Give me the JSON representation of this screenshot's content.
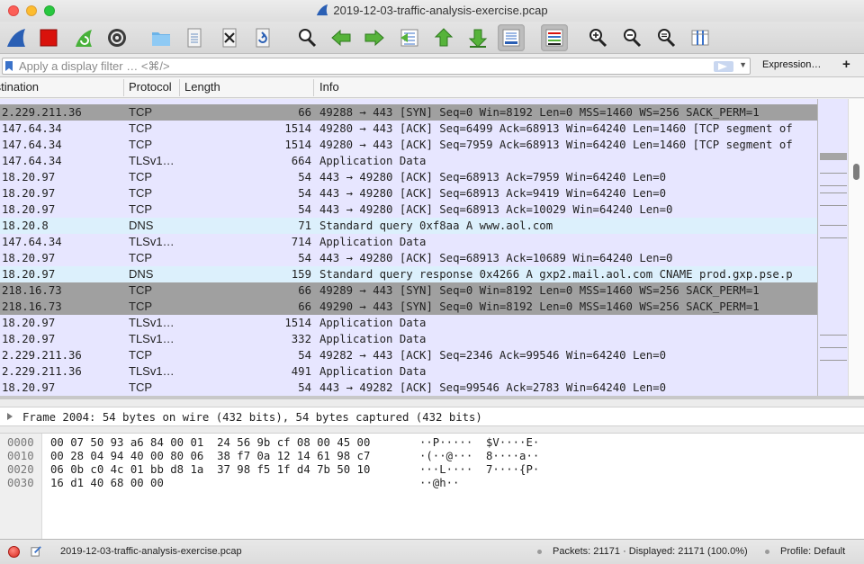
{
  "window": {
    "title": "2019-12-03-traffic-analysis-exercise.pcap"
  },
  "toolbar": {
    "buttons": [
      {
        "name": "start-capture",
        "icon": "shark-fin-icon"
      },
      {
        "name": "stop-capture",
        "icon": "stop-square-icon"
      },
      {
        "name": "restart-capture",
        "icon": "restart-fin-icon"
      },
      {
        "name": "capture-options",
        "icon": "gear-icon"
      },
      {
        "name": "open-file",
        "icon": "folder-icon"
      },
      {
        "name": "save-file",
        "icon": "document-icon"
      },
      {
        "name": "close-file",
        "icon": "close-file-icon"
      },
      {
        "name": "reload-file",
        "icon": "reload-icon"
      },
      {
        "name": "find-packet",
        "icon": "search-icon"
      },
      {
        "name": "go-back",
        "icon": "arrow-left-icon"
      },
      {
        "name": "go-forward",
        "icon": "arrow-right-icon"
      },
      {
        "name": "go-to-packet",
        "icon": "goto-packet-icon"
      },
      {
        "name": "go-first",
        "icon": "arrow-up-icon"
      },
      {
        "name": "go-last",
        "icon": "arrow-down-icon"
      },
      {
        "name": "auto-scroll",
        "icon": "autoscroll-icon"
      },
      {
        "name": "colorize",
        "icon": "colorize-icon"
      },
      {
        "name": "zoom-in",
        "icon": "zoom-in-icon"
      },
      {
        "name": "zoom-out",
        "icon": "zoom-out-icon"
      },
      {
        "name": "normal-size",
        "icon": "zoom-normal-icon"
      },
      {
        "name": "resize-columns",
        "icon": "resize-columns-icon"
      }
    ]
  },
  "filter": {
    "placeholder": "Apply a display filter … <⌘/>",
    "expression_label": "Expression…",
    "add_label": "+"
  },
  "columns": {
    "destination": "Destination",
    "protocol": "Protocol",
    "length": "Length",
    "info": "Info"
  },
  "packets": [
    {
      "dst": "",
      "proto": "",
      "len": "",
      "info": "",
      "kind": "tcp"
    },
    {
      "dst": "2.229.211.36",
      "proto": "TCP",
      "len": "66",
      "info": "49288 → 443 [SYN] Seq=0 Win=8192 Len=0 MSS=1460 WS=256 SACK_PERM=1",
      "kind": "syn"
    },
    {
      "dst": "147.64.34",
      "proto": "TCP",
      "len": "1514",
      "info": "49280 → 443 [ACK] Seq=6499 Ack=68913 Win=64240 Len=1460 [TCP segment of",
      "kind": "tcp"
    },
    {
      "dst": "147.64.34",
      "proto": "TCP",
      "len": "1514",
      "info": "49280 → 443 [ACK] Seq=7959 Ack=68913 Win=64240 Len=1460 [TCP segment of",
      "kind": "tcp"
    },
    {
      "dst": "147.64.34",
      "proto": "TLSv1…",
      "len": "664",
      "info": "Application Data",
      "kind": "tcp"
    },
    {
      "dst": "18.20.97",
      "proto": "TCP",
      "len": "54",
      "info": "443 → 49280 [ACK] Seq=68913 Ack=7959 Win=64240 Len=0",
      "kind": "tcp"
    },
    {
      "dst": "18.20.97",
      "proto": "TCP",
      "len": "54",
      "info": "443 → 49280 [ACK] Seq=68913 Ack=9419 Win=64240 Len=0",
      "kind": "tcp"
    },
    {
      "dst": "18.20.97",
      "proto": "TCP",
      "len": "54",
      "info": "443 → 49280 [ACK] Seq=68913 Ack=10029 Win=64240 Len=0",
      "kind": "tcp"
    },
    {
      "dst": "18.20.8",
      "proto": "DNS",
      "len": "71",
      "info": "Standard query 0xf8aa A www.aol.com",
      "kind": "dns"
    },
    {
      "dst": "147.64.34",
      "proto": "TLSv1…",
      "len": "714",
      "info": "Application Data",
      "kind": "tcp"
    },
    {
      "dst": "18.20.97",
      "proto": "TCP",
      "len": "54",
      "info": "443 → 49280 [ACK] Seq=68913 Ack=10689 Win=64240 Len=0",
      "kind": "tcp"
    },
    {
      "dst": "18.20.97",
      "proto": "DNS",
      "len": "159",
      "info": "Standard query response 0x4266 A gxp2.mail.aol.com CNAME prod.gxp.pse.p",
      "kind": "dns"
    },
    {
      "dst": "218.16.73",
      "proto": "TCP",
      "len": "66",
      "info": "49289 → 443 [SYN] Seq=0 Win=8192 Len=0 MSS=1460 WS=256 SACK_PERM=1",
      "kind": "syn"
    },
    {
      "dst": "218.16.73",
      "proto": "TCP",
      "len": "66",
      "info": "49290 → 443 [SYN] Seq=0 Win=8192 Len=0 MSS=1460 WS=256 SACK_PERM=1",
      "kind": "syn"
    },
    {
      "dst": "18.20.97",
      "proto": "TLSv1…",
      "len": "1514",
      "info": "Application Data",
      "kind": "tcp"
    },
    {
      "dst": "18.20.97",
      "proto": "TLSv1…",
      "len": "332",
      "info": "Application Data",
      "kind": "tcp"
    },
    {
      "dst": "2.229.211.36",
      "proto": "TCP",
      "len": "54",
      "info": "49282 → 443 [ACK] Seq=2346 Ack=99546 Win=64240 Len=0",
      "kind": "tcp"
    },
    {
      "dst": "2.229.211.36",
      "proto": "TLSv1…",
      "len": "491",
      "info": "Application Data",
      "kind": "tcp"
    },
    {
      "dst": "18.20.97",
      "proto": "TCP",
      "len": "54",
      "info": "443 → 49282 [ACK] Seq=99546 Ack=2783 Win=64240 Len=0",
      "kind": "tcp"
    }
  ],
  "details": {
    "frame": "Frame 2004: 54 bytes on wire (432 bits), 54 bytes captured (432 bits)"
  },
  "bytes": [
    {
      "offset": "0000",
      "hex": "00 07 50 93 a6 84 00 01  24 56 9b cf 08 00 45 00",
      "ascii": "··P·····  $V····E·"
    },
    {
      "offset": "0010",
      "hex": "00 28 04 94 40 00 80 06  38 f7 0a 12 14 61 98 c7",
      "ascii": "·(··@···  8····a··"
    },
    {
      "offset": "0020",
      "hex": "06 0b c0 4c 01 bb d8 1a  37 98 f5 1f d4 7b 50 10",
      "ascii": "···L····  7····{P·"
    },
    {
      "offset": "0030",
      "hex": "16 d1 40 68 00 00",
      "ascii": "··@h··"
    }
  ],
  "status": {
    "file": "2019-12-03-traffic-analysis-exercise.pcap",
    "packets": "Packets: 21171 · Displayed: 21171 (100.0%)",
    "profile": "Profile: Default"
  },
  "colors": {
    "tcp_row": "#e7e6ff",
    "syn_row": "#a0a0a0",
    "dns_row": "#dcf0fc",
    "accent": "#3a72c9"
  }
}
